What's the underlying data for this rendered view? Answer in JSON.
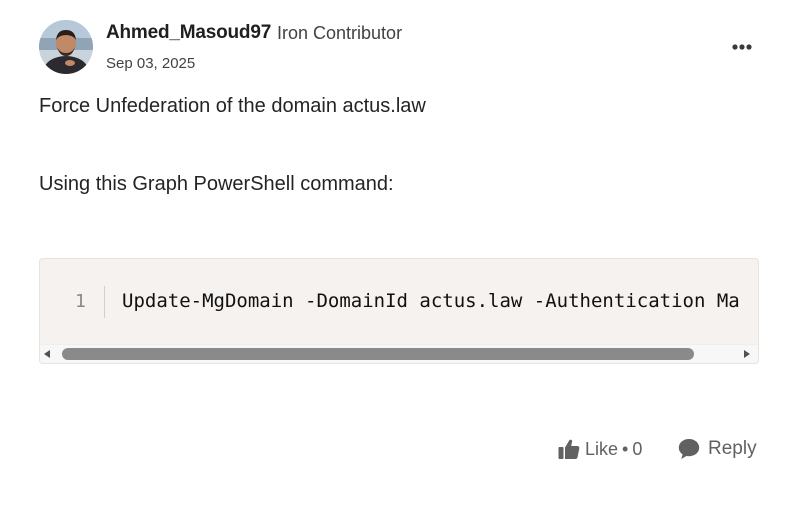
{
  "author": {
    "name": "Ahmed_Masoud97",
    "rank": "Iron Contributor",
    "avatar_icon": "user-avatar-photo"
  },
  "post": {
    "date": "Sep 03, 2025",
    "title": "Force Unfederation of the domain actus.law",
    "paragraph": "Using this Graph PowerShell command:",
    "more_icon": "more-horizontal-icon"
  },
  "code": {
    "line_number": "1",
    "text": "Update-MgDomain -DomainId actus.law -Authentication Ma",
    "scroll_thumb_fraction": 0.93,
    "scroll_position": 0
  },
  "actions": {
    "like_label": "Like",
    "like_separator": "•",
    "like_count": "0",
    "like_icon": "thumbs-up-icon",
    "reply_label": "Reply",
    "reply_icon": "speech-bubble-icon"
  },
  "colors": {
    "code_background": "#f5f2f0",
    "muted_text": "#616161"
  }
}
